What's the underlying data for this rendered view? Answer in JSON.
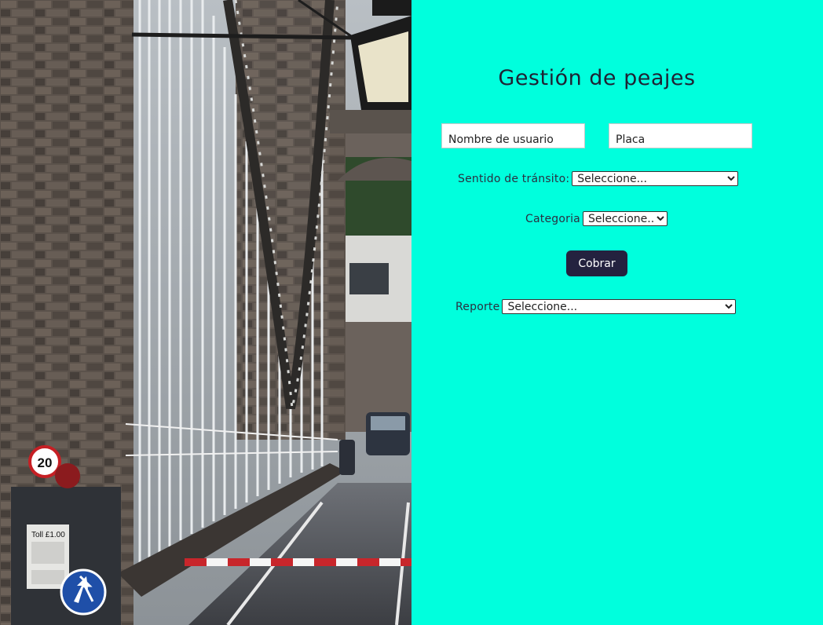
{
  "hero_image": {
    "toll_sign_text": "Toll £1.00",
    "speed_limit_text": "20"
  },
  "form": {
    "title": "Gestión de peajes",
    "username_placeholder": "Nombre de usuario",
    "plate_placeholder": "Placa",
    "direction_label": "Sentido de tránsito:",
    "direction_selected": "Seleccione...",
    "category_label": "Categoria",
    "category_selected": "Seleccione...",
    "charge_button": "Cobrar",
    "report_label": "Reporte",
    "report_selected": "Seleccione..."
  },
  "colors": {
    "panel_background": "#00ffdd",
    "button_background": "#24223f",
    "title_text": "#1f2233"
  }
}
